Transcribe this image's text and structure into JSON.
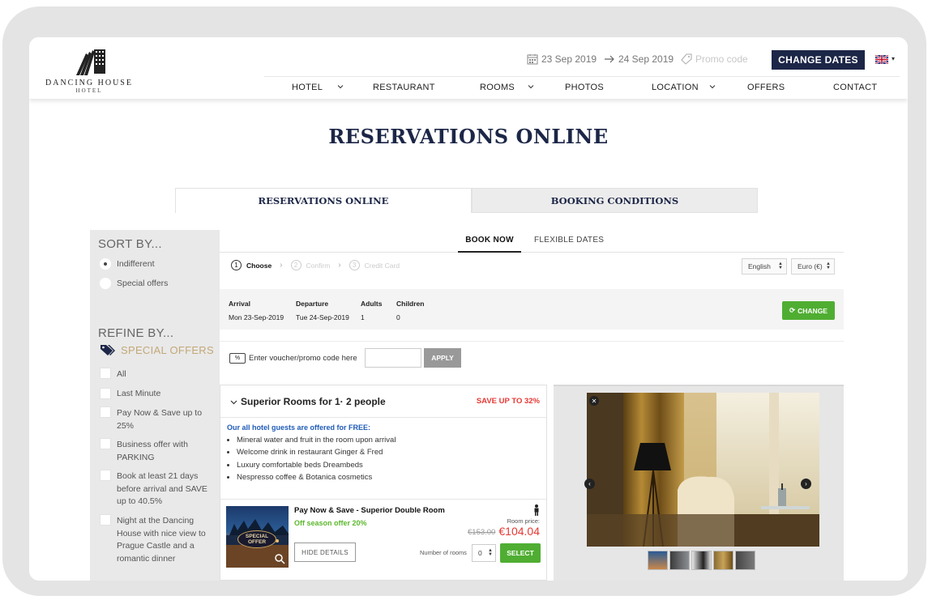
{
  "header": {
    "logo_text": "DANCING HOUSE",
    "logo_sub": "HOTEL",
    "arrival_date": "23 Sep 2019",
    "departure_date": "24 Sep 2019",
    "promo_code": "Promo code",
    "change_dates_label": "CHANGE DATES",
    "language_flag": "uk-flag-icon"
  },
  "nav": {
    "items": [
      {
        "label": "HOTEL",
        "has_dropdown": true
      },
      {
        "label": "RESTAURANT",
        "has_dropdown": false
      },
      {
        "label": "ROOMS",
        "has_dropdown": true
      },
      {
        "label": "PHOTOS",
        "has_dropdown": false
      },
      {
        "label": "LOCATION",
        "has_dropdown": true
      },
      {
        "label": "OFFERS",
        "has_dropdown": false
      },
      {
        "label": "CONTACT",
        "has_dropdown": false
      }
    ]
  },
  "page": {
    "title": "RESERVATIONS ONLINE",
    "tabs": [
      "RESERVATIONS ONLINE",
      "BOOKING CONDITIONS"
    ]
  },
  "sidebar": {
    "sort_heading": "SORT BY...",
    "sort_options": [
      {
        "label": "Indifferent",
        "selected": true
      },
      {
        "label": "Special offers",
        "selected": false
      }
    ],
    "refine_heading": "REFINE BY...",
    "special_offers_label": "SPECIAL OFFERS",
    "filters": [
      "All",
      "Last Minute",
      "Pay Now & Save up to 25%",
      "Business offer with PARKING",
      "Book at least 21 days before arrival and SAVE up to 40.5%",
      "Night at the Dancing House with nice view to Prague Castle and a romantic dinner"
    ]
  },
  "engine": {
    "tabs": [
      "BOOK NOW",
      "FLEXIBLE DATES"
    ],
    "steps": [
      {
        "num": "1",
        "label": "Choose",
        "active": true
      },
      {
        "num": "2",
        "label": "Confirm",
        "active": false
      },
      {
        "num": "3",
        "label": "Credit Card",
        "active": false
      }
    ],
    "language_select": "English",
    "currency_select": "Euro (€)",
    "search": {
      "arrival_label": "Arrival",
      "arrival_value": "Mon 23-Sep-2019",
      "departure_label": "Departure",
      "departure_value": "Tue 24-Sep-2019",
      "adults_label": "Adults",
      "adults_value": "1",
      "children_label": "Children",
      "children_value": "0",
      "change_label": "CHANGE"
    },
    "voucher": {
      "icon_text": "%",
      "label": "Enter voucher/promo code here",
      "value": "",
      "apply_label": "APPLY"
    },
    "room": {
      "title": "Superior Rooms for 1· 2 people",
      "save_label": "SAVE UP TO 32%",
      "perks_title": "Our all hotel guests are offered for FREE:",
      "perks": [
        "Mineral water and fruit in the room upon arrival",
        "Welcome drink in restaurant Ginger & Fred",
        "Luxury comfortable beds Dreambeds",
        "Nespresso coffee & Botanica cosmetics"
      ],
      "rate": {
        "name": "Pay Now & Save - Superior Double Room",
        "offer": "Off season offer 20%",
        "badge_text": "SPECIAL OFFER",
        "price_label": "Room price:",
        "price_old": "€153.00",
        "price_new": "€104.04",
        "hide_details_label": "HIDE DETAILS",
        "rooms_label": "Number of rooms",
        "rooms_value": "0",
        "select_label": "SELECT"
      }
    },
    "gallery": {
      "thumb_count": 5
    }
  },
  "colors": {
    "navy": "#1c2647",
    "green": "#4fae32",
    "red": "#e53935",
    "gold": "#c3a877",
    "blue_link": "#1e5bb8"
  }
}
